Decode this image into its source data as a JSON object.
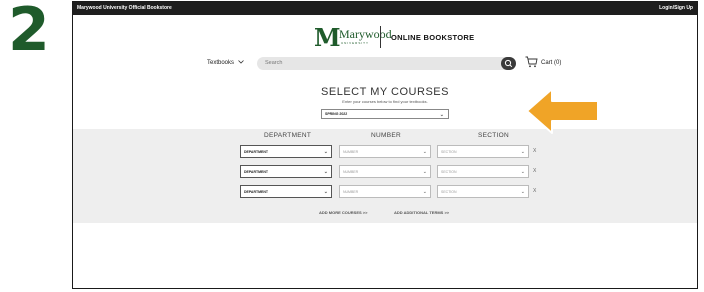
{
  "step_number": "2",
  "topbar": {
    "left_text": "Marywood University Official Bookstore",
    "right_text": "Login/Sign Up"
  },
  "logo": {
    "name": "Marywood",
    "subtitle": "UNIVERSITY"
  },
  "header": {
    "store_title": "ONLINE BOOKSTORE"
  },
  "nav": {
    "textbooks_label": "Textbooks",
    "search_placeholder": "Search",
    "cart_label": "Cart (0)"
  },
  "courses": {
    "title": "SELECT MY COURSES",
    "subtitle": "Enter your courses below to find your textbooks.",
    "term_value": "SPRING 2022",
    "columns": [
      "DEPARTMENT",
      "NUMBER",
      "SECTION"
    ],
    "rows": [
      {
        "department": "DEPARTMENT",
        "number": "NUMBER",
        "section": "SECTION",
        "remove": "X"
      },
      {
        "department": "DEPARTMENT",
        "number": "NUMBER",
        "section": "SECTION",
        "remove": "X"
      },
      {
        "department": "DEPARTMENT",
        "number": "NUMBER",
        "section": "SECTION",
        "remove": "X"
      }
    ],
    "add_more": "ADD MORE COURSES >>",
    "add_terms": "ADD ADDITIONAL TERMS >>"
  },
  "colors": {
    "brand_green": "#1f5b2b",
    "arrow_orange": "#f0a427",
    "topbar": "#1e1e1e"
  },
  "icons": [
    "search-icon",
    "cart-icon",
    "chevron-down-icon",
    "arrow-left-icon"
  ]
}
